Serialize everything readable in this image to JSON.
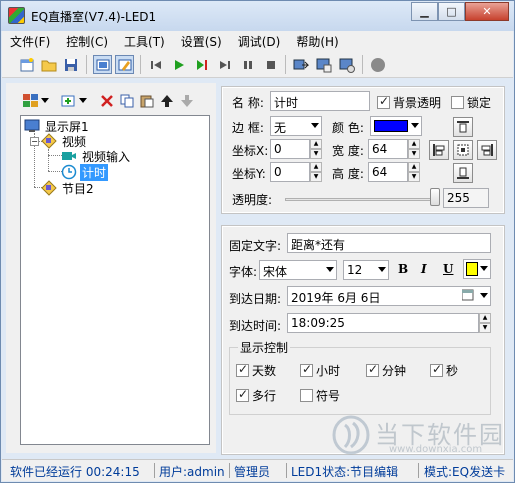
{
  "window": {
    "title": "EQ直播室(V7.4)-LED1"
  },
  "menu": [
    "文件(F)",
    "控制(C)",
    "工具(T)",
    "设置(S)",
    "调试(D)",
    "帮助(H)"
  ],
  "tree": {
    "screen": "显示屏1",
    "program1": "视频",
    "item_video_input": "视频输入",
    "item_timer": "计时",
    "program2": "节目2"
  },
  "props": {
    "name_label": "名 称:",
    "name_value": "计时",
    "bg_transparent_label": "背景透明",
    "bg_transparent": true,
    "lock_label": "锁定",
    "lock": false,
    "border_label": "边 框:",
    "border_value": "无",
    "color_label": "颜 色:",
    "color_value": "#0000ff",
    "x_label": "坐标X:",
    "x_value": "0",
    "width_label": "宽 度:",
    "width_value": "64",
    "y_label": "坐标Y:",
    "y_value": "0",
    "height_label": "高 度:",
    "height_value": "64",
    "opacity_label": "透明度:",
    "opacity_value": "255",
    "opacity_level": 1.0
  },
  "content": {
    "fixed_text_label": "固定文字:",
    "fixed_text_value": "距离*还有",
    "font_label": "字体:",
    "font_value": "宋体",
    "size_value": "12",
    "bold": "B",
    "italic": "I",
    "underline": "U",
    "text_color": "#ffff00",
    "date_label": "到达日期:",
    "date_value": "2019年 6月 6日",
    "time_label": "到达时间:",
    "time_value": "18:09:25",
    "display_group": "显示控制",
    "opt_days": "天数",
    "opt_hours": "小时",
    "opt_minutes": "分钟",
    "opt_seconds": "秒",
    "opt_multiline": "多行",
    "opt_sign": "符号",
    "days_checked": true,
    "hours_checked": true,
    "minutes_checked": true,
    "seconds_checked": true,
    "multiline_checked": true,
    "sign_checked": false
  },
  "status": {
    "uptime": "软件已经运行 00:24:15",
    "user": "用户:admin",
    "role": "管理员",
    "led_state": "LED1状态:节目编辑",
    "mode": "模式:EQ发送卡"
  },
  "watermark": {
    "text": "当下软件园",
    "url": "www.downxia.com"
  },
  "colors": {
    "accent_blue": "#003c9a",
    "selection": "#3399ff"
  }
}
